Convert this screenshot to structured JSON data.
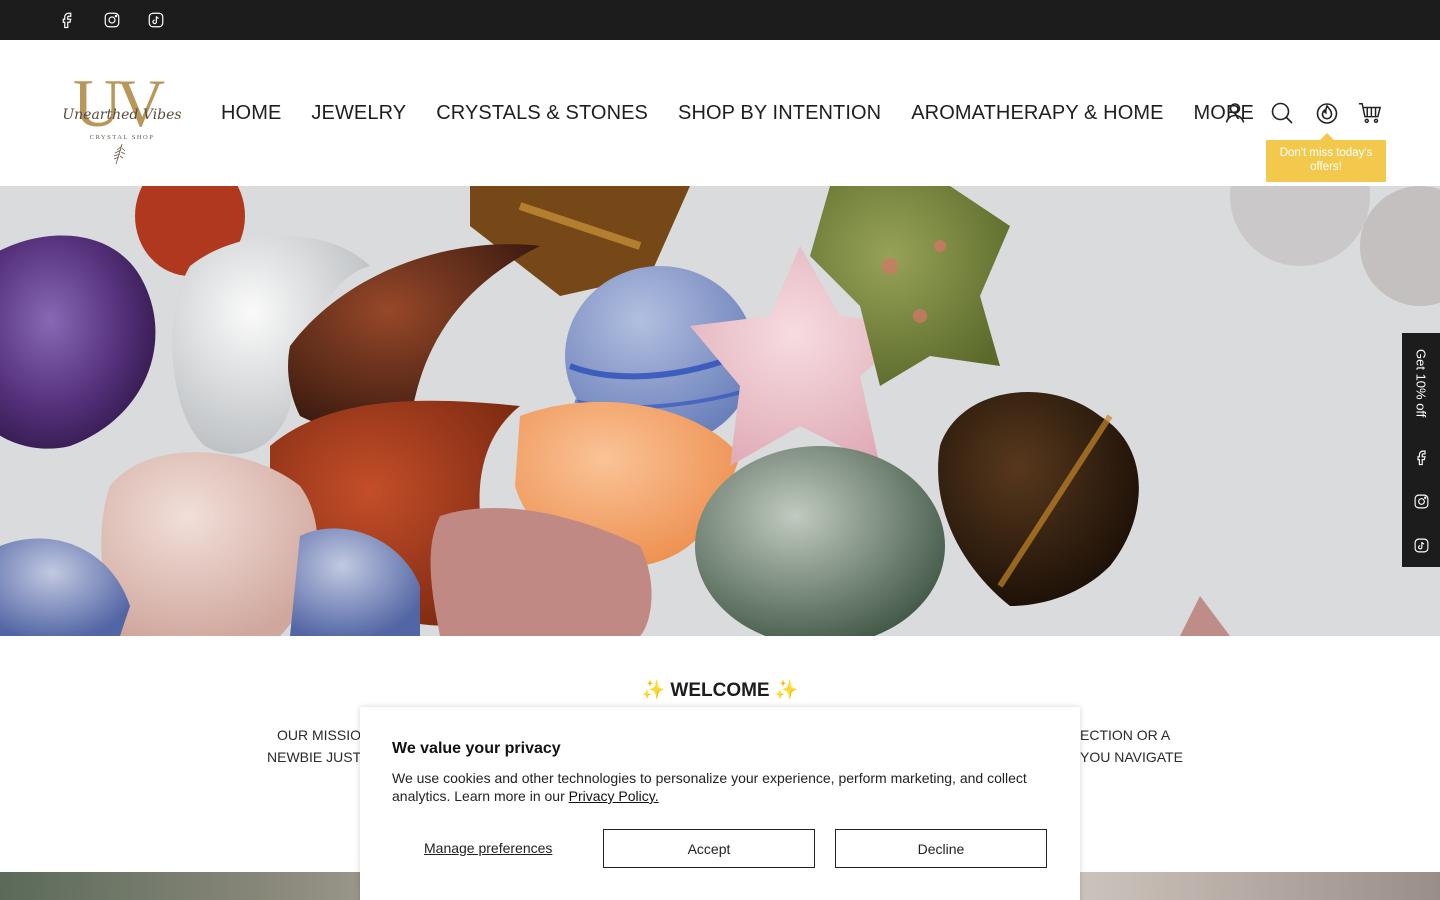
{
  "topbar": {
    "social": [
      "facebook-icon",
      "instagram-icon",
      "tiktok-icon"
    ]
  },
  "header": {
    "logo": {
      "letters": "UV",
      "script": "Unearthed Vibes",
      "sub": "CRYSTAL SHOP"
    },
    "nav": [
      "HOME",
      "JEWELRY",
      "CRYSTALS & STONES",
      "SHOP BY INTENTION",
      "AROMATHERAPY & HOME",
      "MORE"
    ],
    "icons": [
      "account-icon",
      "search-icon",
      "flame-icon",
      "cart-icon"
    ],
    "tooltip": "Don't miss today's offers!"
  },
  "side_widget": {
    "offer": "Get 10% off",
    "icons": [
      "facebook-icon",
      "instagram-icon",
      "tiktok-icon"
    ]
  },
  "welcome": {
    "title": "✨ WELCOME ✨",
    "line1_left": "OUR MISSION",
    "line1_right": "ECTION OR A",
    "line2_left": "NEWBIE JUST C",
    "line2_right": "YOU NAVIGATE"
  },
  "cookie": {
    "title": "We value your privacy",
    "text": "We use cookies and other technologies to personalize your experience, perform marketing, and collect analytics. Learn more in our ",
    "link": "Privacy Policy.",
    "manage": "Manage preferences",
    "accept": "Accept",
    "decline": "Decline"
  },
  "colors": {
    "topbar": "#1c1c1c",
    "tooltip": "#f2c94c",
    "logo_gold": "#b9975b"
  }
}
